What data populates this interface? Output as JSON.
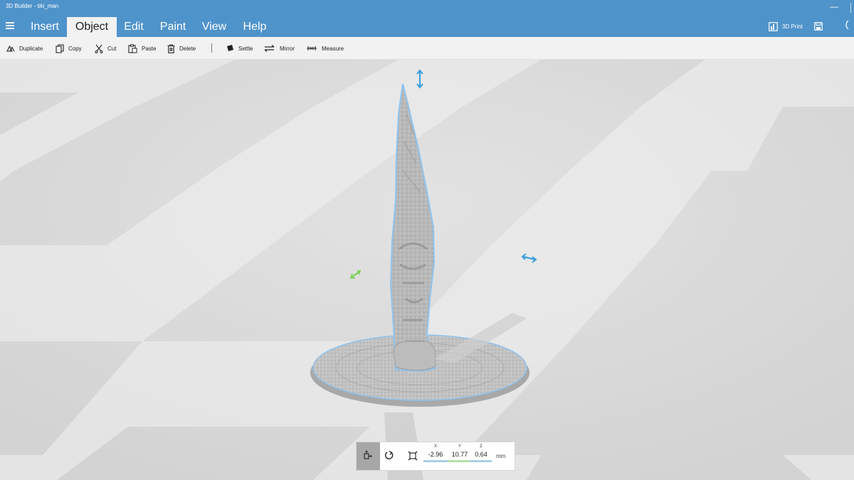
{
  "window": {
    "title": "3D Builder - tiki_man",
    "minimize": "—"
  },
  "menu": {
    "tabs": [
      {
        "label": "Insert"
      },
      {
        "label": "Object"
      },
      {
        "label": "Edit"
      },
      {
        "label": "Paint"
      },
      {
        "label": "View"
      },
      {
        "label": "Help"
      }
    ],
    "active_tab": "Object",
    "print_label": "3D Print"
  },
  "toolbar": {
    "duplicate": "Duplicate",
    "copy": "Copy",
    "cut": "Cut",
    "paste": "Paste",
    "delete": "Delete",
    "settle": "Settle",
    "mirror": "Mirror",
    "measure": "Measure"
  },
  "transform": {
    "x_label": "X",
    "y_label": "Y",
    "z_label": "Z",
    "x_value": "-2.96",
    "y_value": "10.77",
    "z_value": "0.64",
    "unit": "mm",
    "x_color": "#a9cfe6",
    "y_color": "#b6e0a6",
    "z_color": "#a9cfe6"
  },
  "colors": {
    "accent": "#4f93cb",
    "gizmo_blue": "#3ba0e0",
    "gizmo_green": "#7ccf5a",
    "selection_outline": "#8fc3ee"
  },
  "icons": [
    "hamburger-icon",
    "print-icon",
    "save-icon",
    "duplicate-icon",
    "copy-icon",
    "cut-icon",
    "paste-icon",
    "delete-icon",
    "settle-icon",
    "mirror-icon",
    "measure-icon",
    "move-icon",
    "rotate-icon",
    "scale-icon"
  ]
}
